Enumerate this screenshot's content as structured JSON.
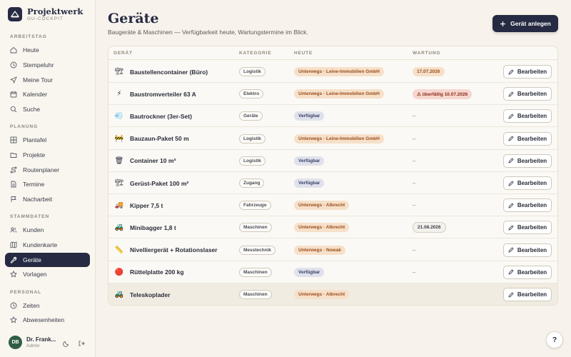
{
  "brand": {
    "name": "Projektwerk",
    "sub": "GU-COCKPIT"
  },
  "nav": {
    "sections": [
      {
        "label": "ARBEITSTAG",
        "items": [
          {
            "label": "Heute",
            "icon": "home-icon"
          },
          {
            "label": "Stempeluhr",
            "icon": "clock-icon"
          },
          {
            "label": "Meine Tour",
            "icon": "navigation-icon"
          },
          {
            "label": "Kalender",
            "icon": "calendar-icon"
          },
          {
            "label": "Suche",
            "icon": "search-icon"
          }
        ]
      },
      {
        "label": "PLANUNG",
        "items": [
          {
            "label": "Plantafel",
            "icon": "grid-icon"
          },
          {
            "label": "Projekte",
            "icon": "folder-icon"
          },
          {
            "label": "Routenplaner",
            "icon": "route-icon"
          },
          {
            "label": "Termine",
            "icon": "document-icon"
          },
          {
            "label": "Nacharbeit",
            "icon": "flag-icon"
          }
        ]
      },
      {
        "label": "STAMMDATEN",
        "items": [
          {
            "label": "Kunden",
            "icon": "users-icon"
          },
          {
            "label": "Kundenkarte",
            "icon": "map-icon"
          },
          {
            "label": "Geräte",
            "icon": "wrench-icon",
            "active": true
          },
          {
            "label": "Vorlagen",
            "icon": "star-icon"
          }
        ]
      },
      {
        "label": "PERSONAL",
        "items": [
          {
            "label": "Zeiten",
            "icon": "clock-icon"
          },
          {
            "label": "Abwesenheiten",
            "icon": "star-icon"
          }
        ]
      }
    ]
  },
  "user": {
    "initials": "DB",
    "name": "Dr. Frank...",
    "role": "Admin"
  },
  "page": {
    "title": "Geräte",
    "subtitle": "Baugeräte & Maschinen — Verfügbarkeit heute, Wartungstermine im Blick.",
    "add_label": "Gerät anlegen"
  },
  "table": {
    "headers": {
      "name": "GERÄT",
      "category": "KATEGORIE",
      "today": "HEUTE",
      "maintenance": "WARTUNG"
    },
    "edit_label": "Bearbeiten",
    "rows": [
      {
        "emoji": "🏗",
        "name": "Baustellencontainer (Büro)",
        "category": "Logistik",
        "status": "Unterwegs · Leine-Immobilien GmbH",
        "status_type": "away",
        "maintenance": "17.07.2026",
        "maint_type": "soon"
      },
      {
        "emoji": "⚡",
        "name": "Baustromverteiler 63 A",
        "category": "Elektro",
        "status": "Unterwegs · Leine-Immobilien GmbH",
        "status_type": "away",
        "maintenance": "⚠ überfällig 10.07.2026",
        "maint_type": "overdue"
      },
      {
        "emoji": "💨",
        "name": "Bautrockner (3er-Set)",
        "category": "Geräte",
        "status": "Verfügbar",
        "status_type": "free",
        "maintenance": "–",
        "maint_type": "none"
      },
      {
        "emoji": "🚧",
        "name": "Bauzaun-Paket 50 m",
        "category": "Logistik",
        "status": "Unterwegs · Leine-Immobilien GmbH",
        "status_type": "away",
        "maintenance": "–",
        "maint_type": "none"
      },
      {
        "emoji": "🗑",
        "name": "Container 10 m³",
        "category": "Logistik",
        "status": "Verfügbar",
        "status_type": "free",
        "maintenance": "–",
        "maint_type": "none"
      },
      {
        "emoji": "🏗",
        "name": "Gerüst-Paket 100 m²",
        "category": "Zugang",
        "status": "Verfügbar",
        "status_type": "free",
        "maintenance": "–",
        "maint_type": "none"
      },
      {
        "emoji": "🚚",
        "name": "Kipper 7,5 t",
        "category": "Fahrzeuge",
        "status": "Unterwegs · Albrecht",
        "status_type": "away",
        "maintenance": "–",
        "maint_type": "none"
      },
      {
        "emoji": "🚜",
        "name": "Minibagger 1,8 t",
        "category": "Maschinen",
        "status": "Unterwegs · Albrecht",
        "status_type": "away",
        "maintenance": "21.08.2026",
        "maint_type": "ok"
      },
      {
        "emoji": "📏",
        "name": "Nivelliergerät + Rotationslaser",
        "category": "Messtechnik",
        "status": "Unterwegs · Nowak",
        "status_type": "away",
        "maintenance": "–",
        "maint_type": "none"
      },
      {
        "emoji": "🔴",
        "name": "Rüttelplatte 200 kg",
        "category": "Maschinen",
        "status": "Verfügbar",
        "status_type": "free",
        "maintenance": "–",
        "maint_type": "none"
      },
      {
        "emoji": "🚜",
        "name": "Teleskoplader",
        "category": "Maschinen",
        "status": "Unterwegs · Albrecht",
        "status_type": "away",
        "maintenance": "",
        "maint_type": "none",
        "highlight": true
      }
    ]
  },
  "help_label": "?",
  "colors": {
    "primary": "#262a42",
    "away_bg": "#f6e0c9",
    "away_fg": "#9b4d1c",
    "free_bg": "#dfe1ec",
    "overdue_bg": "#f6d7cf",
    "avatar": "#2f5c45"
  }
}
